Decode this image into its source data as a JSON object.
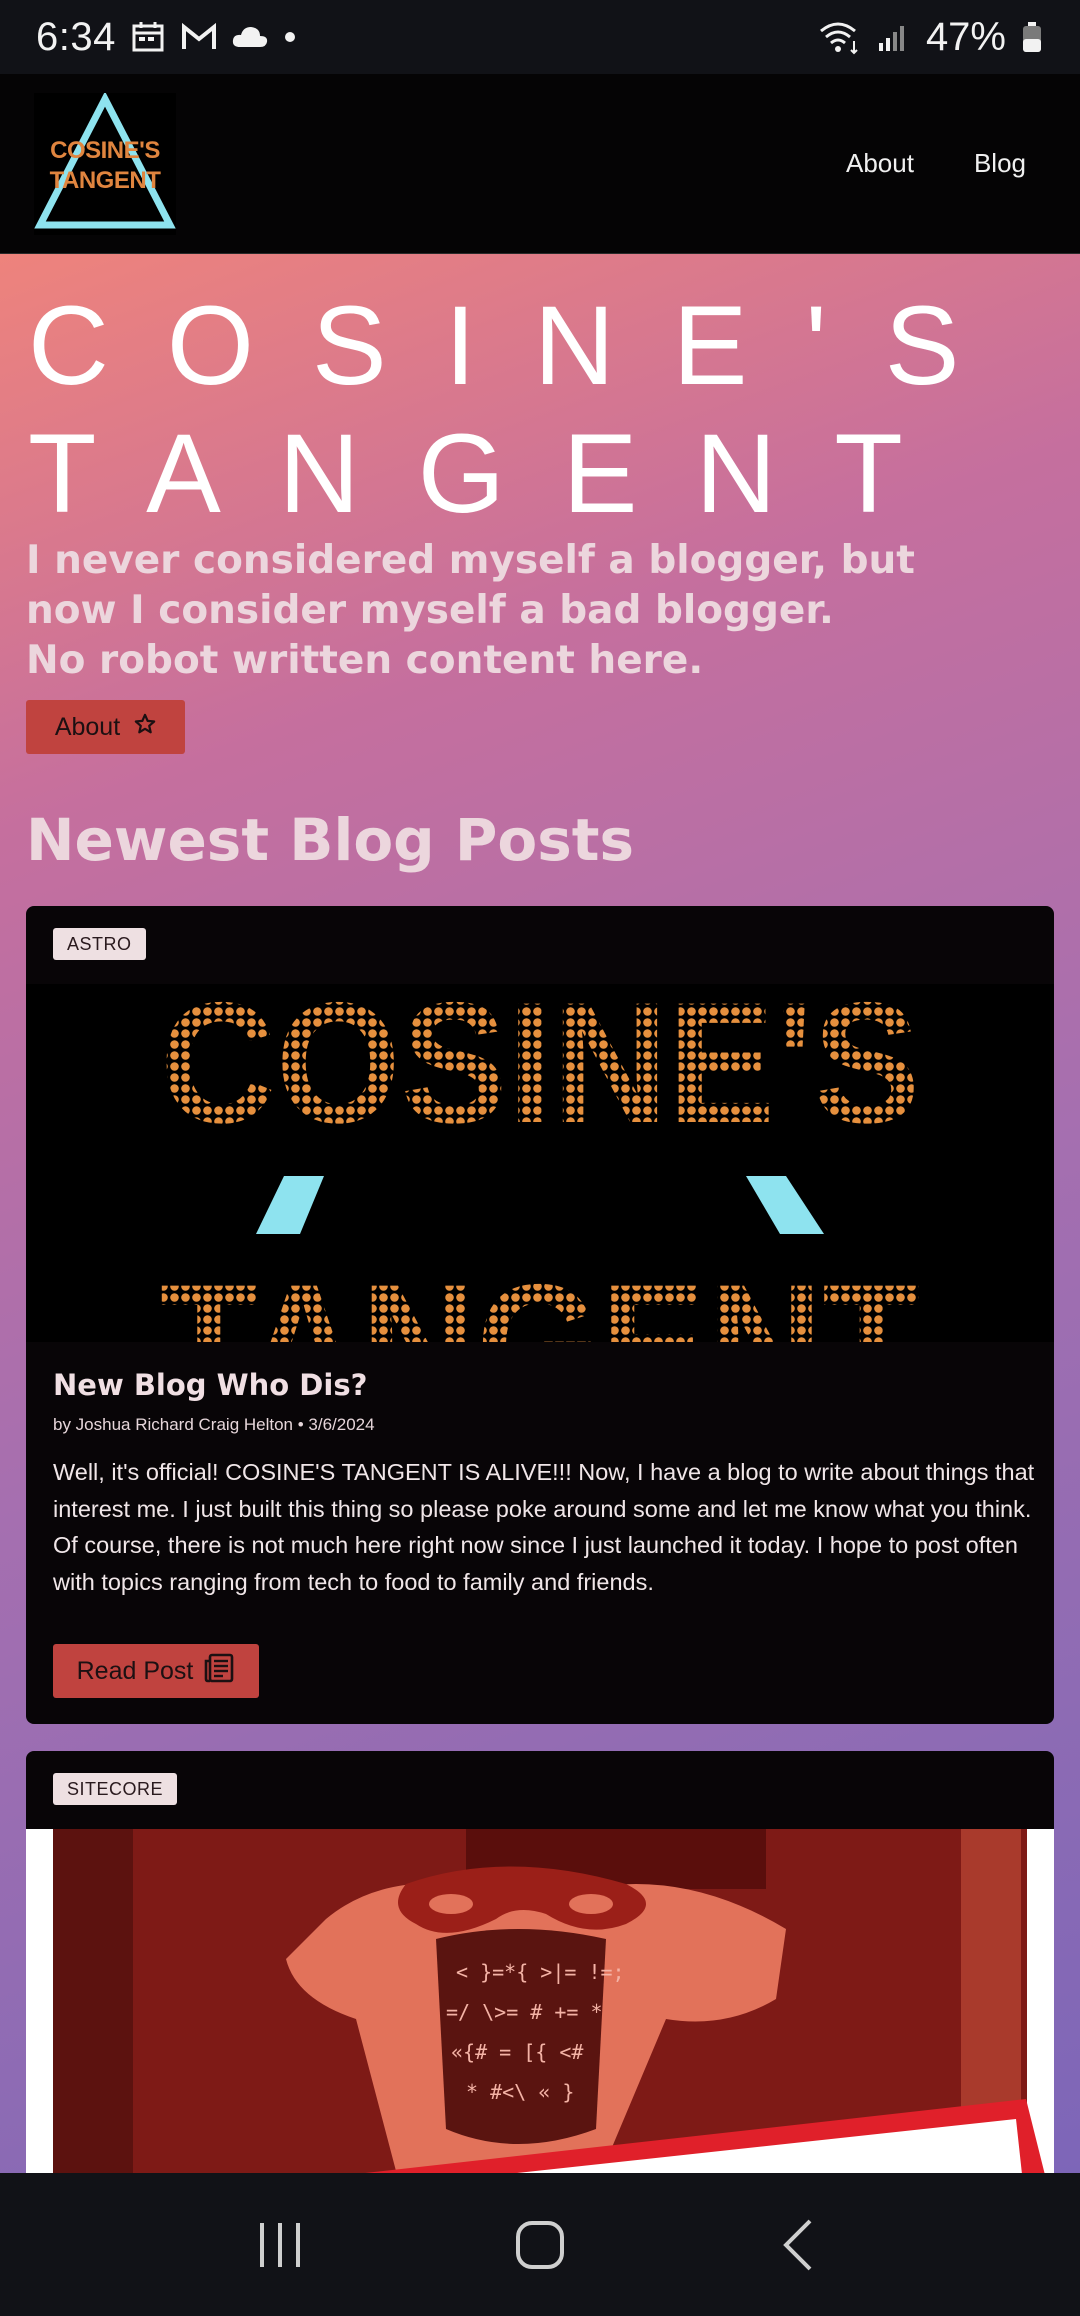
{
  "status_bar": {
    "time": "6:34",
    "battery": "47%",
    "left_icons": [
      "calendar-icon",
      "gmail-icon",
      "cloud-icon",
      "dot-icon"
    ],
    "right_icons": [
      "wifi-icon",
      "signal-icon",
      "battery-icon"
    ]
  },
  "header": {
    "logo_line1": "COSINE'S",
    "logo_line2": "TANGENT",
    "nav": [
      "About",
      "Blog"
    ]
  },
  "hero": {
    "title_line1": "COSINE'S",
    "title_line2": "TANGENT",
    "tagline_line1": "I never considered myself a blogger, but",
    "tagline_line2": "now I consider myself a bad blogger.",
    "tagline_line3": "No robot written content here.",
    "about_button": "About"
  },
  "section": {
    "title": "Newest Blog Posts"
  },
  "posts": [
    {
      "tag": "ASTRO",
      "image_line1": "COSINE'S",
      "image_line2": "TANGENT",
      "title": "New Blog Who Dis?",
      "meta": "by Joshua Richard Craig Helton • 3/6/2024",
      "excerpt": "Well, it's official! COSINE'S TANGENT IS ALIVE!!! Now, I have a blog to write about things that interest me. I just built this thing so please poke around some and let me know what you think. Of course, there is not much here right now since I just launched it today. I hope to post often with topics ranging from tech to food to family and friends.",
      "read_button": "Read Post"
    },
    {
      "tag": "SITECORE"
    }
  ],
  "colors": {
    "accent_button": "#c0433f",
    "card_bg": "#080507",
    "logo_cyan": "#8ee3ef",
    "logo_orange": "#e0853f"
  }
}
